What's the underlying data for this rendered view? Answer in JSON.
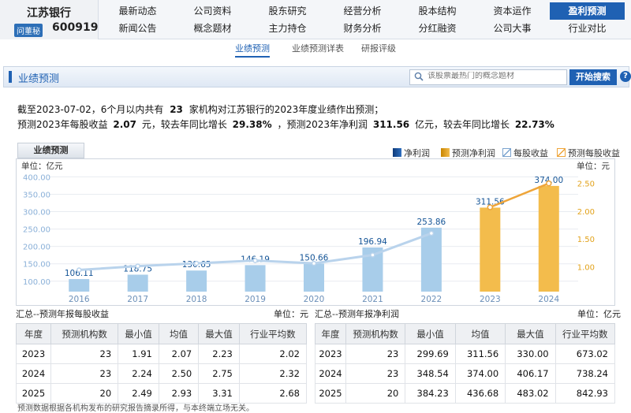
{
  "stock": {
    "name": "江苏银行",
    "badge": "问董秘",
    "code": "600919"
  },
  "nav": {
    "row1": [
      "最新动态",
      "公司资料",
      "股东研究",
      "经营分析",
      "股本结构",
      "资本运作",
      "盈利预测"
    ],
    "row2": [
      "新闻公告",
      "概念题材",
      "主力持仓",
      "财务分析",
      "分红融资",
      "公司大事",
      "行业对比"
    ],
    "active": "盈利预测"
  },
  "subnav": [
    "业绩预测",
    "业绩预测详表",
    "研报评级"
  ],
  "panel": {
    "title": "业绩预测",
    "search_placeholder": "该股票最热门的概念题材",
    "search_button": "开始搜索",
    "help": "?"
  },
  "summary": {
    "line1_pre": "截至2023-07-02，6个月以内共有",
    "line1_count": "23",
    "line1_post": "家机构对江苏银行的2023年度业绩作出预测；",
    "line2_a": "预测2023年每股收益",
    "line2_eps": "2.07",
    "line2_b": "元，较去年同比增长",
    "line2_eps_growth": "29.38%",
    "line2_c": "，预测2023年净利润",
    "line2_np": "311.56",
    "line2_d": "亿元，较去年同比增长",
    "line2_np_growth": "22.73%"
  },
  "chart_tab": "业绩预测",
  "legend": [
    "净利润",
    "预测净利润",
    "每股收益",
    "预测每股收益"
  ],
  "colors": {
    "bar": "#a8cdea",
    "forecast_bar": "#f3bc4c",
    "line": "#b9d3ec",
    "forecast_line": "#eea53a",
    "accent": "#1f61b3"
  },
  "chart_data": {
    "type": "bar",
    "categories": [
      "2016",
      "2017",
      "2018",
      "2019",
      "2020",
      "2021",
      "2022",
      "2023",
      "2024"
    ],
    "series": [
      {
        "name": "净利润",
        "values": [
          106.11,
          118.75,
          130.65,
          146.19,
          150.66,
          196.94,
          253.86,
          null,
          null
        ]
      },
      {
        "name": "预测净利润",
        "values": [
          null,
          null,
          null,
          null,
          null,
          null,
          null,
          311.56,
          374.0
        ]
      },
      {
        "name": "每股收益",
        "values": [
          0.94,
          1.01,
          1.06,
          1.11,
          1.06,
          1.21,
          1.6,
          null,
          null
        ]
      },
      {
        "name": "预测每股收益",
        "values": [
          null,
          null,
          null,
          null,
          null,
          null,
          null,
          2.07,
          2.5
        ]
      }
    ],
    "value_labels": [
      "106.11",
      "118.75",
      "130.65",
      "146.19",
      "150.66",
      "196.94",
      "253.86",
      "311.56",
      "374.00"
    ],
    "left_unit": "单位：亿元",
    "right_unit": "单位：元",
    "left_ticks": [
      "400.00",
      "350.00",
      "300.00",
      "250.00",
      "200.00",
      "150.00",
      "100.00"
    ],
    "left_tick_values": [
      400,
      350,
      300,
      250,
      200,
      150,
      100
    ],
    "right_ticks": [
      "2.50",
      "2.00",
      "1.50",
      "1.00"
    ],
    "right_tick_values": [
      2.5,
      2.0,
      1.5,
      1.0
    ],
    "ylim": [
      70,
      410
    ],
    "y2lim": [
      0.55,
      2.68
    ],
    "grid": true
  },
  "eps_table": {
    "caption": "汇总--预测年报每股收益",
    "unit": "单位：元",
    "headers": [
      "年度",
      "预测机构数",
      "最小值",
      "均值",
      "最大值",
      "行业平均数"
    ],
    "rows": [
      [
        "2023",
        "23",
        "1.91",
        "2.07",
        "2.23",
        "2.02"
      ],
      [
        "2024",
        "23",
        "2.24",
        "2.50",
        "2.75",
        "2.32"
      ],
      [
        "2025",
        "20",
        "2.49",
        "2.93",
        "3.31",
        "2.68"
      ]
    ]
  },
  "np_table": {
    "caption": "汇总--预测年报净利润",
    "unit": "单位：亿元",
    "headers": [
      "年度",
      "预测机构数",
      "最小值",
      "均值",
      "最大值",
      "行业平均数"
    ],
    "rows": [
      [
        "2023",
        "23",
        "299.69",
        "311.56",
        "330.00",
        "673.02"
      ],
      [
        "2024",
        "23",
        "348.54",
        "374.00",
        "406.17",
        "738.24"
      ],
      [
        "2025",
        "20",
        "384.23",
        "436.68",
        "483.02",
        "842.93"
      ]
    ]
  },
  "footnote": "预测数据根据各机构发布的研究报告摘录所得，与本终端立场无关。"
}
